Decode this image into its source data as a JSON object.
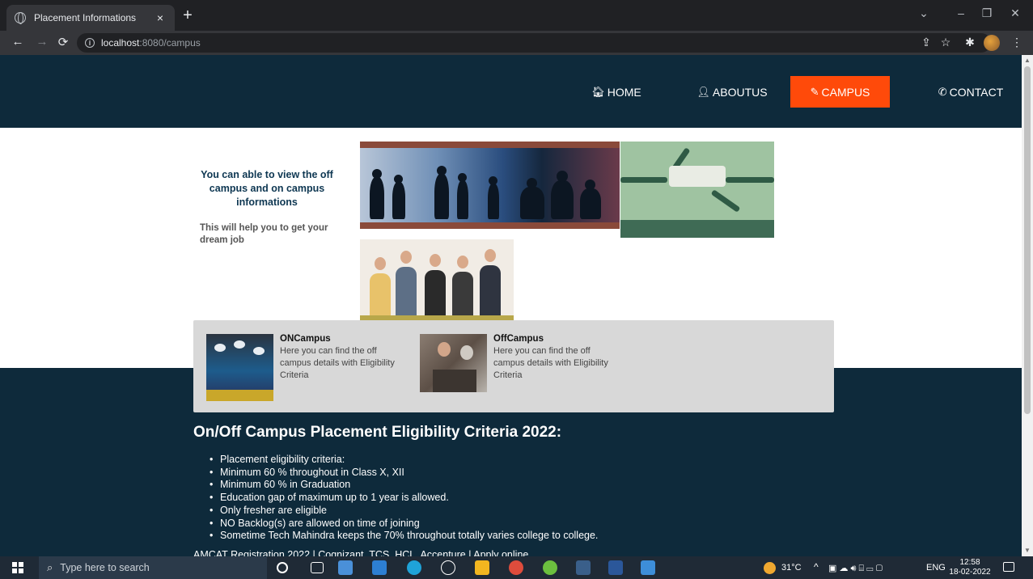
{
  "browser": {
    "tab_title": "Placement Informations",
    "tab_close": "×",
    "new_tab": "+",
    "url_host": "localhost",
    "url_path": ":8080/campus"
  },
  "nav": {
    "items": [
      {
        "label": "HOME",
        "icon": "home-icon",
        "active": false
      },
      {
        "label": "ABOUTUS",
        "icon": "user-icon",
        "active": false
      },
      {
        "label": "CAMPUS",
        "icon": "edit-icon",
        "active": true
      },
      {
        "label": "CONTACT",
        "icon": "phone-icon",
        "active": false
      }
    ],
    "active_color": "#ff4a0a",
    "background": "#0e2a3b"
  },
  "intro": {
    "heading": "You can able to view the off campus and on campus informations",
    "sub": "This will help you to get your dream job"
  },
  "campus": {
    "on": {
      "title": "ONCampus",
      "desc": "Here you can find the off campus details with Eligibility Criteria"
    },
    "off": {
      "title": "OffCampus",
      "desc": "Here you can find the off campus details with Eligibility Criteria"
    }
  },
  "criteria": {
    "heading": "On/Off Campus Placement Eligibility Criteria 2022:",
    "items": [
      "Placement eligibility criteria:",
      "Minimum 60 % throughout in Class X, XII",
      "Minimum 60 % in Graduation",
      "Education gap of maximum up to 1 year is allowed.",
      "Only fresher are eligible",
      "NO Backlog(s) are allowed on time of joining",
      "Sometime Tech Mahindra keeps the 70% throughout totally varies college to college."
    ],
    "footer_line": "AMCAT Registration 2022 | Cognizant, TCS, HCL, Accenture | Apply online"
  },
  "taskbar": {
    "search_placeholder": "Type here to search",
    "weather": "31°C",
    "language": "ENG",
    "time": "12:58",
    "date": "18-02-2022"
  }
}
